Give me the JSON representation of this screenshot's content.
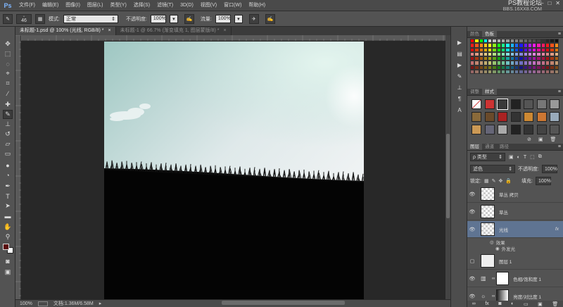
{
  "app": {
    "logo": "Ps"
  },
  "menu": [
    "文件(F)",
    "编辑(E)",
    "图像(I)",
    "图层(L)",
    "类型(Y)",
    "选择(S)",
    "滤镜(T)",
    "3D(D)",
    "视图(V)",
    "窗口(W)",
    "帮助(H)"
  ],
  "watermark": {
    "line1": "PS教程论坛",
    "line2": "BBS.16XX8.COM"
  },
  "window_controls": [
    "–",
    "□",
    "✕"
  ],
  "options": {
    "brush_size": "46",
    "mode_label": "模式:",
    "mode_value": "正常",
    "opacity_label": "不透明度:",
    "opacity_value": "100%",
    "flow_label": "流量:",
    "flow_value": "100%"
  },
  "tabs": [
    {
      "label": "未标题-1.psd @ 100% (光线, RGB/8) *",
      "close": "×"
    },
    {
      "label": "未标题-1 @ 66.7% (渐变填充 1, 图层蒙版/8) *",
      "close": "×"
    }
  ],
  "status": {
    "zoom": "100%",
    "doc": "文档:1.36M/6.58M"
  },
  "colors": {
    "foreground": "#5a0c0c",
    "background": "#ffffff",
    "selected_layer": "#5f7492"
  },
  "panels": {
    "color_tabs": [
      "颜色",
      "色板"
    ],
    "style_tabs": [
      "调整",
      "样式"
    ],
    "layer_tabs": [
      "图层",
      "通道",
      "路径"
    ]
  },
  "layers_panel": {
    "filter_kind": "ρ 类型",
    "blend_mode": "滤色",
    "opacity_label": "不透明度:",
    "opacity_value": "100%",
    "lock_label": "锁定:",
    "fill_label": "填充:",
    "fill_value": "100%"
  },
  "layers": [
    {
      "name": "草丛 拷贝",
      "visible": true
    },
    {
      "name": "草丛",
      "visible": true
    },
    {
      "name": "光线",
      "visible": true,
      "selected": true,
      "fx": "fx"
    },
    {
      "name": "图层 1",
      "visible": false
    },
    {
      "name": "色相/饱和度 1",
      "visible": true
    },
    {
      "name": "亮度/对比度 1",
      "visible": true
    }
  ],
  "effects": {
    "label": "效果",
    "items": [
      "外发光"
    ]
  }
}
